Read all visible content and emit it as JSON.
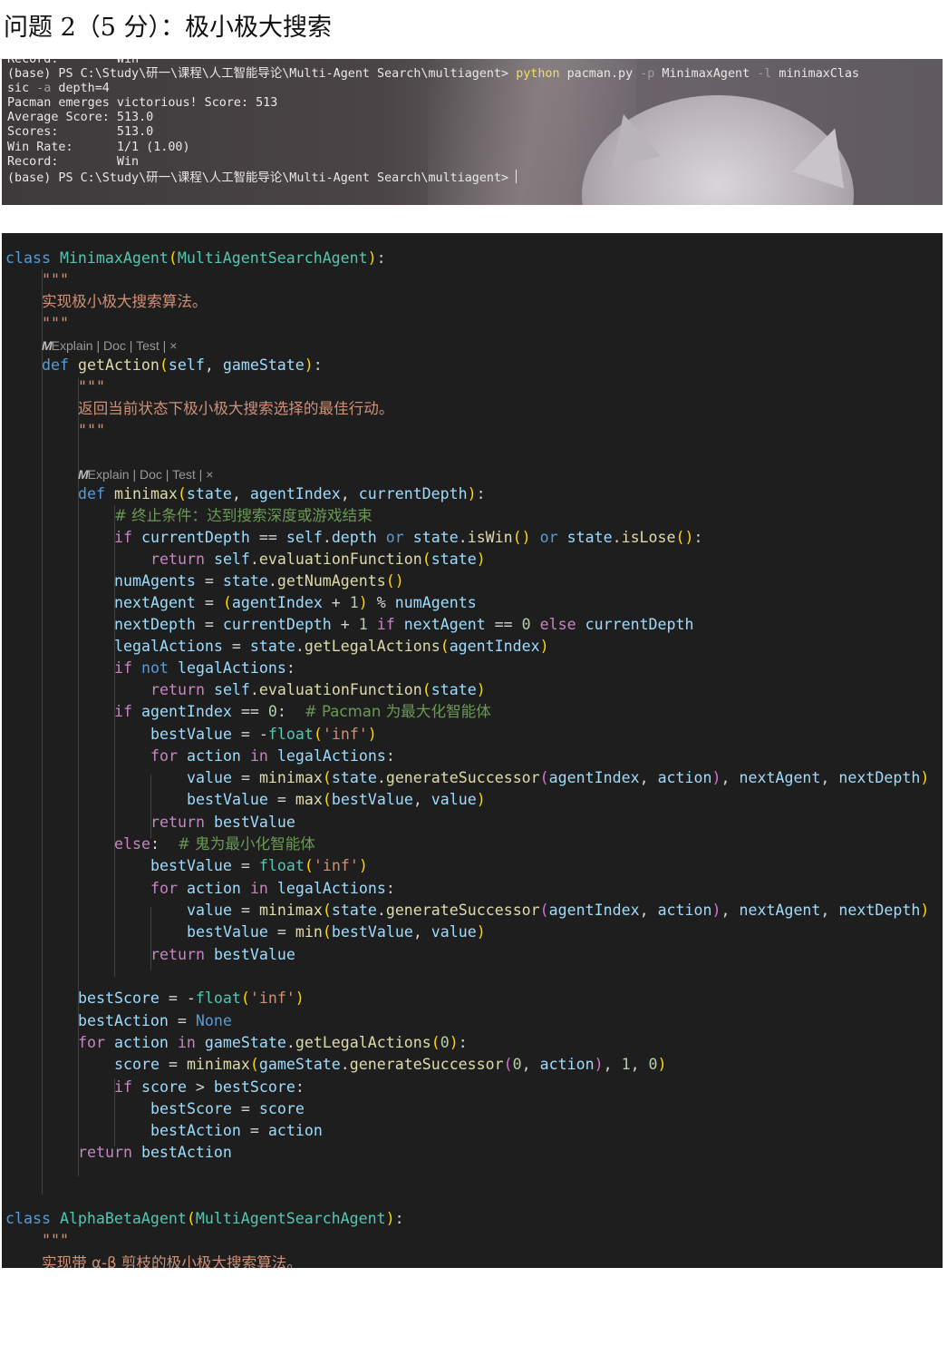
{
  "heading": "问题 2（5 分）：极小极大搜索",
  "terminal": {
    "line0": "Record:        Win",
    "prompt_prefix": "(base) PS C:\\Study\\研一\\课程\\人工智能导论\\Multi-Agent Search\\multiagent> ",
    "cmd_python": "python",
    "cmd_file": " pacman.py ",
    "flag_p": "-p",
    "arg_agent": " MinimaxAgent ",
    "flag_l": "-l",
    "arg_layout_1": " minimaxClas",
    "arg_layout_2": "sic ",
    "flag_a": "-a",
    "arg_depth": " depth=4",
    "result": "Pacman emerges victorious! Score: 513",
    "average": "Average Score: 513.0",
    "scores": "Scores:        513.0",
    "winrate": "Win Rate:      1/1 (1.00)",
    "record": "Record:        Win",
    "final_prompt": "(base) PS C:\\Study\\研一\\课程\\人工智能导论\\Multi-Agent Search\\multiagent> "
  },
  "codelens": {
    "explain": "Explain",
    "doc": "Doc",
    "test": "Test",
    "close": "×",
    "sep": " | "
  },
  "code": {
    "minimax_class": "MinimaxAgent",
    "base_class": "MultiAgentSearchAgent",
    "doc_quote": "\"\"\"",
    "class_doc": "实现极小极大搜索算法。",
    "getaction_doc": "返回当前状态下极小极大搜索选择的最佳行动。",
    "comment_terminal": "# 终止条件：达到搜索深度或游戏结束",
    "comment_pacman": "# Pacman 为最大化智能体",
    "comment_ghost": "# 鬼为最小化智能体",
    "alphabeta_class": "AlphaBetaAgent",
    "alphabeta_doc": "实现带 α-β 剪枝的极小极大搜索算法。"
  }
}
